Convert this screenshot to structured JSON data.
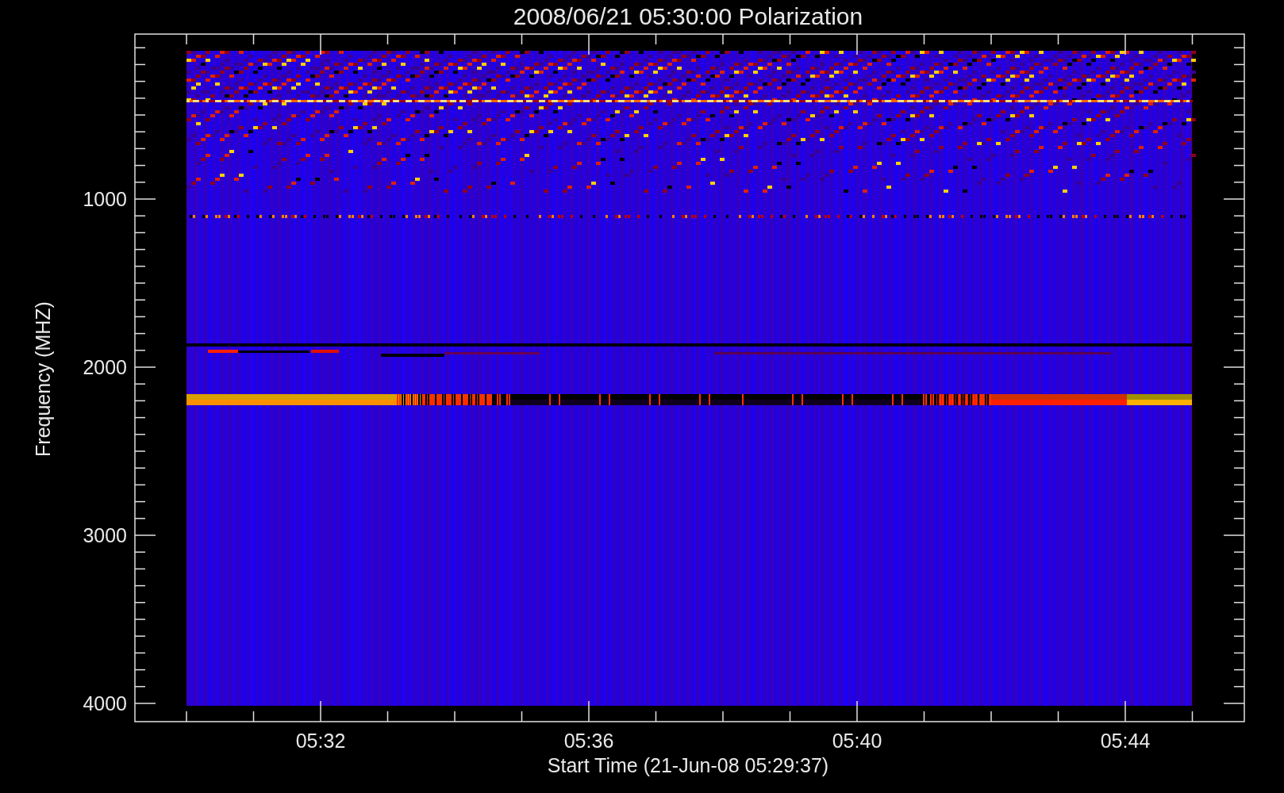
{
  "title": "2008/06/21 05:30:00 Polarization",
  "y_axis": {
    "label": "Frequency (MHZ)",
    "ticks": [
      "1000",
      "2000",
      "3000",
      "4000"
    ]
  },
  "x_axis": {
    "label": "Start Time (21-Jun-08 05:29:37)",
    "ticks": [
      "05:32",
      "05:36",
      "05:40",
      "05:44"
    ]
  }
}
